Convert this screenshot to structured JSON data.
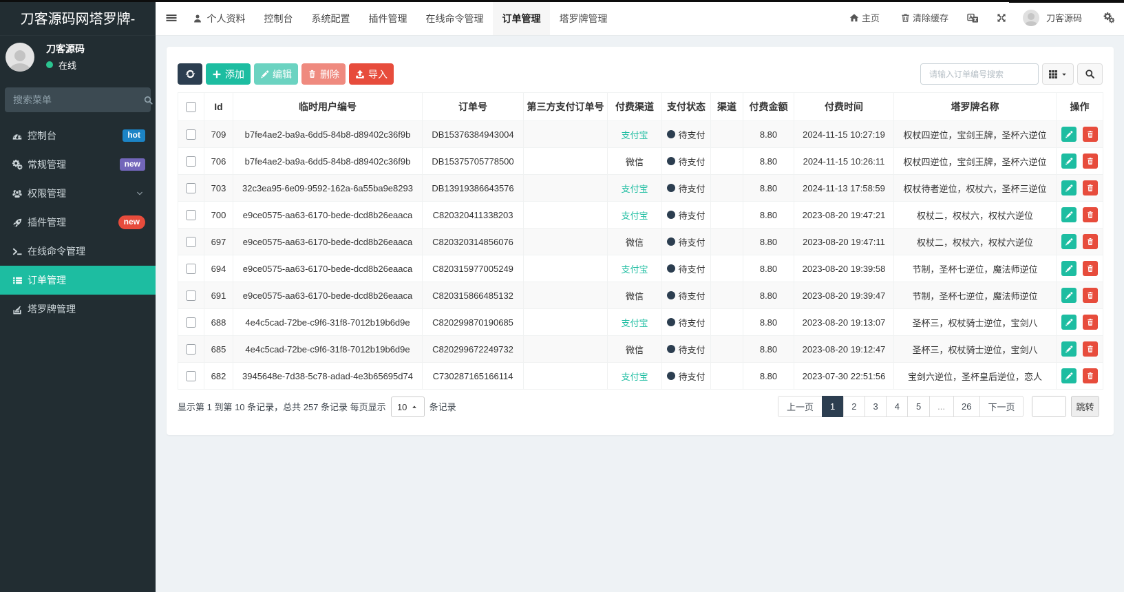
{
  "sidebar": {
    "logo": "刀客源码网塔罗牌-",
    "user": {
      "name": "刀客源码",
      "status": "在线"
    },
    "search_placeholder": "搜索菜单",
    "menu": [
      {
        "label": "控制台",
        "icon": "dashboard-icon",
        "badge": "hot",
        "badge_color": "#1c84c6",
        "badge_pill": false
      },
      {
        "label": "常规管理",
        "icon": "gears-icon",
        "badge": "new",
        "badge_color": "#7266ba",
        "badge_pill": false
      },
      {
        "label": "权限管理",
        "icon": "users-icon",
        "chevron": true
      },
      {
        "label": "插件管理",
        "icon": "rocket-icon",
        "badge": "new",
        "badge_color": "#e74c3c",
        "badge_pill": true
      },
      {
        "label": "在线命令管理",
        "icon": "terminal-icon"
      },
      {
        "label": "订单管理",
        "icon": "list-icon",
        "active": true
      },
      {
        "label": "塔罗牌管理",
        "icon": "stack-icon"
      }
    ]
  },
  "topbar": {
    "tabs": [
      {
        "label": "个人资料",
        "icon": "user-icon"
      },
      {
        "label": "控制台"
      },
      {
        "label": "系统配置"
      },
      {
        "label": "插件管理"
      },
      {
        "label": "在线命令管理"
      },
      {
        "label": "订单管理",
        "active": true
      },
      {
        "label": "塔罗牌管理"
      }
    ],
    "right": {
      "home": "主页",
      "clear_cache": "清除缓存",
      "username": "刀客源码"
    }
  },
  "toolbar": {
    "add_label": "添加",
    "edit_label": "编辑",
    "delete_label": "删除",
    "import_label": "导入",
    "search_placeholder": "请输入订单编号搜索"
  },
  "table": {
    "columns": [
      "",
      "Id",
      "临时用户编号",
      "订单号",
      "第三方支付订单号",
      "付费渠道",
      "支付状态",
      "渠道",
      "付费金额",
      "付费时间",
      "塔罗牌名称",
      "操作"
    ],
    "rows": [
      {
        "id": "709",
        "uuid": "b7fe4ae2-ba9a-6dd5-84b8-d89402c36f9b",
        "order_no": "DB15376384943004",
        "third_party_no": "",
        "pay_channel": "支付宝",
        "pay_channel_is_link": true,
        "pay_status": "待支付",
        "channel": "",
        "amount": "8.80",
        "pay_time": "2024-11-15 10:27:19",
        "tarot_names": "权杖四逆位，宝剑王牌，圣杯六逆位"
      },
      {
        "id": "706",
        "uuid": "b7fe4ae2-ba9a-6dd5-84b8-d89402c36f9b",
        "order_no": "DB15375705778500",
        "third_party_no": "",
        "pay_channel": "微信",
        "pay_channel_is_link": false,
        "pay_status": "待支付",
        "channel": "",
        "amount": "8.80",
        "pay_time": "2024-11-15 10:26:11",
        "tarot_names": "权杖四逆位，宝剑王牌，圣杯六逆位"
      },
      {
        "id": "703",
        "uuid": "32c3ea95-6e09-9592-162a-6a55ba9e8293",
        "order_no": "DB13919386643576",
        "third_party_no": "",
        "pay_channel": "支付宝",
        "pay_channel_is_link": true,
        "pay_status": "待支付",
        "channel": "",
        "amount": "8.80",
        "pay_time": "2024-11-13 17:58:59",
        "tarot_names": "权杖待者逆位，权杖六，圣杯三逆位"
      },
      {
        "id": "700",
        "uuid": "e9ce0575-aa63-6170-bede-dcd8b26eaaca",
        "order_no": "C820320411338203",
        "third_party_no": "",
        "pay_channel": "支付宝",
        "pay_channel_is_link": true,
        "pay_status": "待支付",
        "channel": "",
        "amount": "8.80",
        "pay_time": "2023-08-20 19:47:21",
        "tarot_names": "权杖二，权杖六，权杖六逆位"
      },
      {
        "id": "697",
        "uuid": "e9ce0575-aa63-6170-bede-dcd8b26eaaca",
        "order_no": "C820320314856076",
        "third_party_no": "",
        "pay_channel": "微信",
        "pay_channel_is_link": false,
        "pay_status": "待支付",
        "channel": "",
        "amount": "8.80",
        "pay_time": "2023-08-20 19:47:11",
        "tarot_names": "权杖二，权杖六，权杖六逆位"
      },
      {
        "id": "694",
        "uuid": "e9ce0575-aa63-6170-bede-dcd8b26eaaca",
        "order_no": "C820315977005249",
        "third_party_no": "",
        "pay_channel": "支付宝",
        "pay_channel_is_link": true,
        "pay_status": "待支付",
        "channel": "",
        "amount": "8.80",
        "pay_time": "2023-08-20 19:39:58",
        "tarot_names": "节制，圣杯七逆位，魔法师逆位"
      },
      {
        "id": "691",
        "uuid": "e9ce0575-aa63-6170-bede-dcd8b26eaaca",
        "order_no": "C820315866485132",
        "third_party_no": "",
        "pay_channel": "微信",
        "pay_channel_is_link": false,
        "pay_status": "待支付",
        "channel": "",
        "amount": "8.80",
        "pay_time": "2023-08-20 19:39:47",
        "tarot_names": "节制，圣杯七逆位，魔法师逆位"
      },
      {
        "id": "688",
        "uuid": "4e4c5cad-72be-c9f6-31f8-7012b19b6d9e",
        "order_no": "C820299870190685",
        "third_party_no": "",
        "pay_channel": "支付宝",
        "pay_channel_is_link": true,
        "pay_status": "待支付",
        "channel": "",
        "amount": "8.80",
        "pay_time": "2023-08-20 19:13:07",
        "tarot_names": "圣杯三，权杖骑士逆位，宝剑八"
      },
      {
        "id": "685",
        "uuid": "4e4c5cad-72be-c9f6-31f8-7012b19b6d9e",
        "order_no": "C820299672249732",
        "third_party_no": "",
        "pay_channel": "微信",
        "pay_channel_is_link": false,
        "pay_status": "待支付",
        "channel": "",
        "amount": "8.80",
        "pay_time": "2023-08-20 19:12:47",
        "tarot_names": "圣杯三，权杖骑士逆位，宝剑八"
      },
      {
        "id": "682",
        "uuid": "3945648e-7d38-5c78-adad-4e3b65695d74",
        "order_no": "C730287165166114",
        "third_party_no": "",
        "pay_channel": "支付宝",
        "pay_channel_is_link": true,
        "pay_status": "待支付",
        "channel": "",
        "amount": "8.80",
        "pay_time": "2023-07-30 22:51:56",
        "tarot_names": "宝剑六逆位，圣杯皇后逆位，恋人"
      }
    ]
  },
  "pagination": {
    "summary_prefix": "显示第 1 到第 10 条记录，总共 257 条记录 每页显示",
    "page_size": "10",
    "summary_suffix": "条记录",
    "prev_label": "上一页",
    "next_label": "下一页",
    "pages": [
      "1",
      "2",
      "3",
      "4",
      "5",
      "...",
      "26"
    ],
    "active_page": "1",
    "jump_label": "跳转"
  },
  "colors": {
    "accent_teal": "#1dbda1",
    "dark_navy": "#2c3e50",
    "danger_red": "#e74c3c",
    "sidebar_bg": "#222d32"
  }
}
